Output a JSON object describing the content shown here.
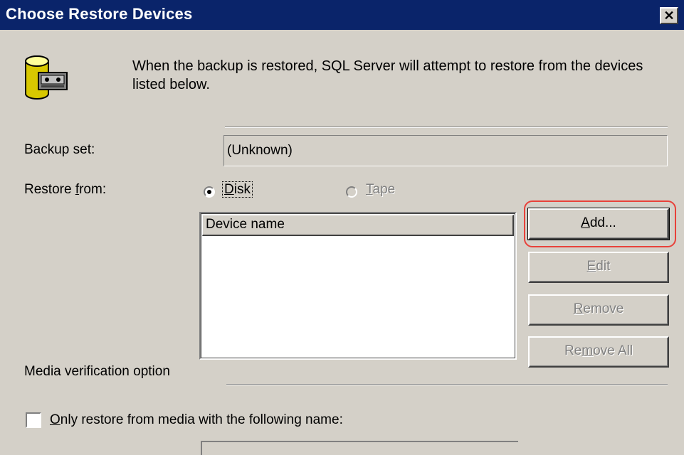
{
  "window": {
    "title": "Choose Restore Devices",
    "close_glyph": "✕",
    "titlebar_color": "#0a246a"
  },
  "intro": {
    "icon": "database-tape-icon",
    "text": "When the backup is restored, SQL Server will attempt to restore from the devices listed below."
  },
  "backup_set": {
    "label": "Backup set:",
    "value": "(Unknown)"
  },
  "restore_from": {
    "label_pre": "Restore ",
    "label_accel": "f",
    "label_post": "rom:",
    "options": [
      {
        "accel": "D",
        "rest": "isk",
        "selected": true,
        "enabled": true
      },
      {
        "accel": "T",
        "rest": "ape",
        "selected": false,
        "enabled": false
      }
    ]
  },
  "device_list": {
    "column_header": "Device name",
    "rows": []
  },
  "buttons": {
    "add": {
      "accel": "A",
      "rest": "dd...",
      "enabled": true
    },
    "edit": {
      "accel": "E",
      "rest": "dit",
      "enabled": false
    },
    "remove": {
      "accel": "R",
      "rest": "emove",
      "enabled": false
    },
    "remove_all": {
      "pre": "Re",
      "accel": "m",
      "rest": "ove All",
      "enabled": false
    }
  },
  "media_verification": {
    "label": "Media verification option",
    "checkbox": {
      "accel": "O",
      "rest": "nly restore from media with the following name:",
      "checked": false
    }
  },
  "colors": {
    "highlight_ring": "#e8413a",
    "face": "#d4d0c8"
  }
}
